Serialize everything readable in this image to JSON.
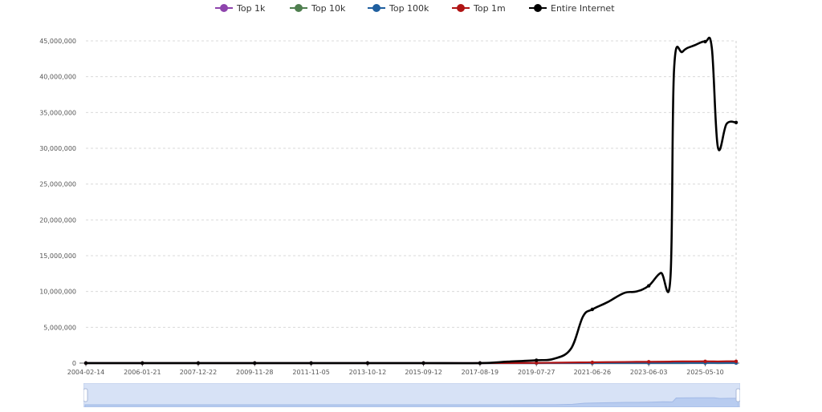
{
  "legend": {
    "items": [
      {
        "label": "Top 1k",
        "color": "#8e44ad"
      },
      {
        "label": "Top 10k",
        "color": "#4f7f4f"
      },
      {
        "label": "Top 100k",
        "color": "#1f5f9f"
      },
      {
        "label": "Top 1m",
        "color": "#b01414"
      },
      {
        "label": "Entire Internet",
        "color": "#000000"
      }
    ]
  },
  "chart_data": {
    "type": "line",
    "title": "",
    "xlabel": "",
    "ylabel": "",
    "x_tick_labels": [
      "2004-02-14",
      "2006-01-21",
      "2007-12-22",
      "2009-11-28",
      "2011-11-05",
      "2013-10-12",
      "2015-09-12",
      "2017-08-19",
      "2019-07-27",
      "2021-06-26",
      "2023-06-03",
      "2025-05-10"
    ],
    "y_tick_labels": [
      "0",
      "5,000,000",
      "10,000,000",
      "15,000,000",
      "20,000,000",
      "25,000,000",
      "30,000,000",
      "35,000,000",
      "40,000,000",
      "45,000,000"
    ],
    "ylim": [
      0,
      45000000
    ],
    "xlim": [
      "2004-02-14",
      "2026-06-01"
    ],
    "grid": "horizontal dashed",
    "legend_position": "top",
    "x": [
      "2004-02-14",
      "2005-06-01",
      "2006-01-21",
      "2007-12-22",
      "2009-11-28",
      "2011-11-05",
      "2013-10-12",
      "2015-09-12",
      "2017-08-19",
      "2018-08-01",
      "2019-07-27",
      "2020-03-01",
      "2020-10-01",
      "2021-03-01",
      "2021-06-26",
      "2022-01-01",
      "2022-08-01",
      "2023-01-01",
      "2023-06-03",
      "2023-11-01",
      "2024-03-01",
      "2024-04-15",
      "2024-08-01",
      "2025-01-01",
      "2025-05-10",
      "2025-08-01",
      "2025-10-15",
      "2026-02-01",
      "2026-06-01"
    ],
    "series": [
      {
        "name": "Entire Internet",
        "color": "#000000",
        "values": [
          0,
          0,
          0,
          0,
          0,
          0,
          0,
          0,
          0,
          200000,
          400000,
          600000,
          2000000,
          6500000,
          7500000,
          8500000,
          9800000,
          10000000,
          10800000,
          12600000,
          12000000,
          41000000,
          43500000,
          44400000,
          44900000,
          44000000,
          30200000,
          33400000,
          33600000
        ]
      },
      {
        "name": "Top 1m",
        "color": "#b01414",
        "values": [
          0,
          0,
          0,
          0,
          0,
          0,
          0,
          0,
          0,
          15000,
          30000,
          60000,
          80000,
          100000,
          110000,
          140000,
          160000,
          180000,
          190000,
          200000,
          210000,
          230000,
          240000,
          240000,
          250000,
          240000,
          230000,
          250000,
          250000
        ]
      },
      {
        "name": "Top 100k",
        "color": "#1f5f9f",
        "values": [
          0,
          0,
          0,
          0,
          0,
          0,
          0,
          0,
          0,
          2000,
          4000,
          8000,
          12000,
          15000,
          18000,
          20000,
          24000,
          26000,
          28000,
          30000,
          32000,
          35000,
          36000,
          37000,
          38000,
          37000,
          36000,
          38000,
          38000
        ]
      },
      {
        "name": "Top 10k",
        "color": "#4f7f4f",
        "values": [
          0,
          0,
          0,
          0,
          0,
          0,
          0,
          0,
          0,
          300,
          600,
          1000,
          1500,
          2000,
          2300,
          2600,
          3000,
          3200,
          3400,
          3600,
          3800,
          4000,
          4200,
          4300,
          4400,
          4300,
          4200,
          4400,
          4400
        ]
      },
      {
        "name": "Top 1k",
        "color": "#8e44ad",
        "values": [
          0,
          0,
          0,
          0,
          0,
          0,
          0,
          0,
          0,
          30,
          60,
          100,
          150,
          200,
          230,
          260,
          300,
          320,
          340,
          360,
          380,
          400,
          420,
          430,
          440,
          430,
          420,
          440,
          440
        ]
      }
    ]
  }
}
